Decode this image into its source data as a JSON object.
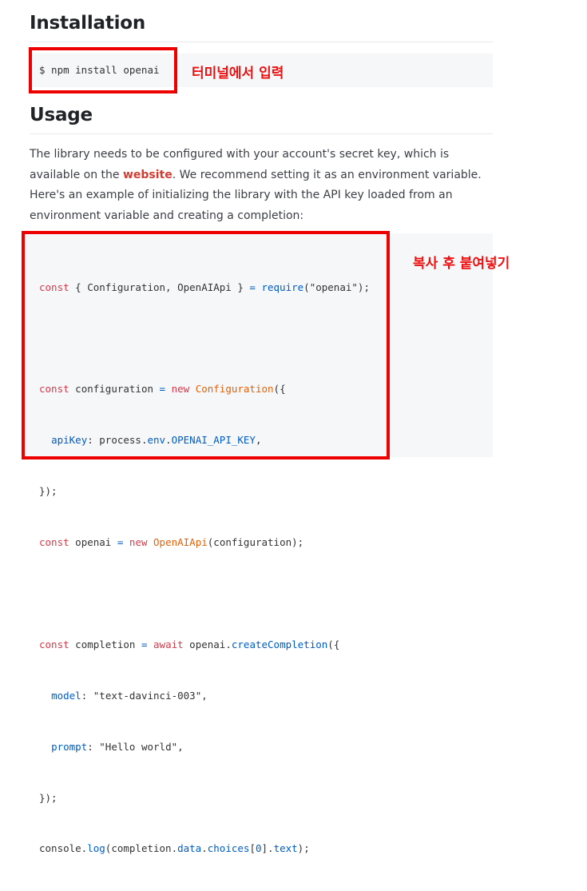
{
  "installation": {
    "heading": "Installation",
    "command": "$ npm install openai",
    "annotation": "터미널에서 입력"
  },
  "usage": {
    "heading": "Usage",
    "paragraph_before_link": "The library needs to be configured with your account's secret key, which is available on the ",
    "link_text": "website",
    "paragraph_after_link": ". We recommend setting it as an environment variable. Here's an example of initializing the library with the API key loaded from an environment variable and creating a completion:",
    "annotation": "복사 후 붙여넣기",
    "code_lines": [
      "const { Configuration, OpenAIApi } = require(\"openai\");",
      "",
      "const configuration = new Configuration({",
      "  apiKey: process.env.OPENAI_API_KEY,",
      "});",
      "const openai = new OpenAIApi(configuration);",
      "",
      "const completion = await openai.createCompletion({",
      "  model: \"text-davinci-003\",",
      "  prompt: \"Hello world\",",
      "});",
      "console.log(completion.data.choices[0].text);"
    ]
  },
  "colors": {
    "annotation_red": "#ee0000",
    "link_red": "#d43a30",
    "code_background": "#f6f7f8",
    "keyword": "#d73a49",
    "class_name": "#e36209",
    "property": "#005cc5"
  }
}
